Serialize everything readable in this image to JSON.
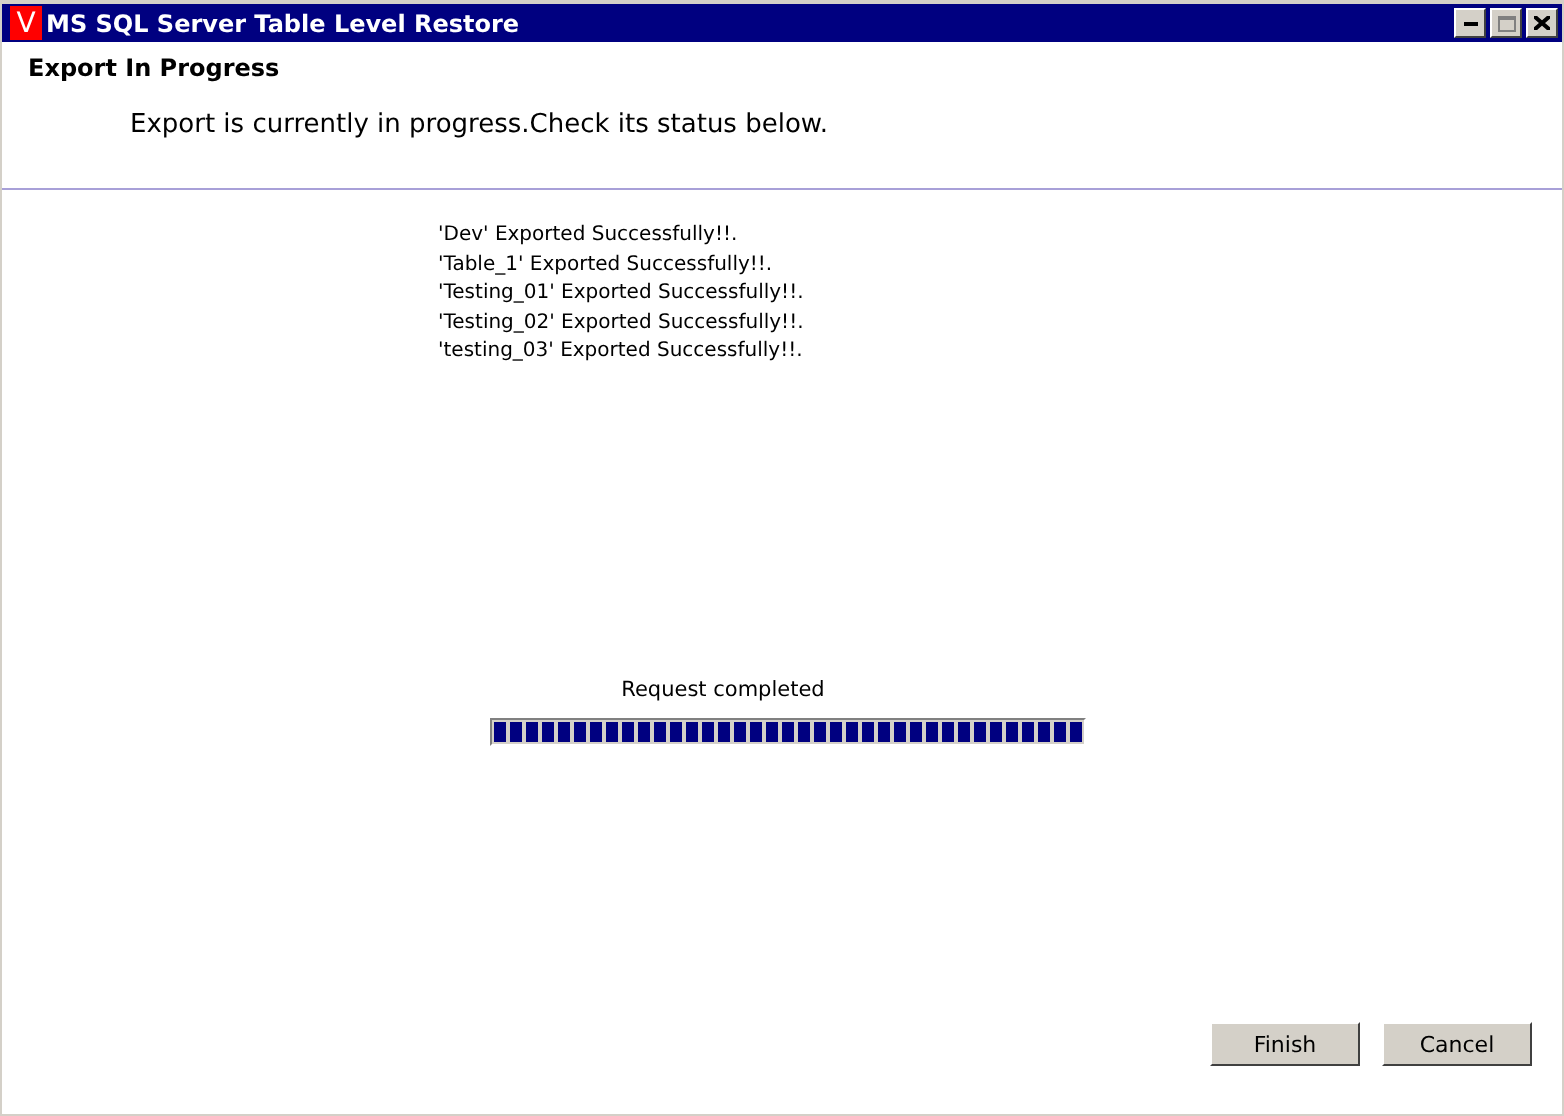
{
  "window": {
    "logo": "V",
    "title": "MS SQL Server Table Level Restore"
  },
  "header": {
    "title": "Export In Progress",
    "subtitle": "Export is currently in progress.Check its status below."
  },
  "log": [
    "'Dev' Exported Successfully!!.",
    "'Table_1' Exported Successfully!!.",
    "'Testing_01' Exported Successfully!!.",
    "'Testing_02' Exported Successfully!!.",
    "'testing_03' Exported Successfully!!."
  ],
  "progress": {
    "label": "Request completed",
    "level": 1
  },
  "buttons": [
    "Finish",
    "Cancel"
  ]
}
